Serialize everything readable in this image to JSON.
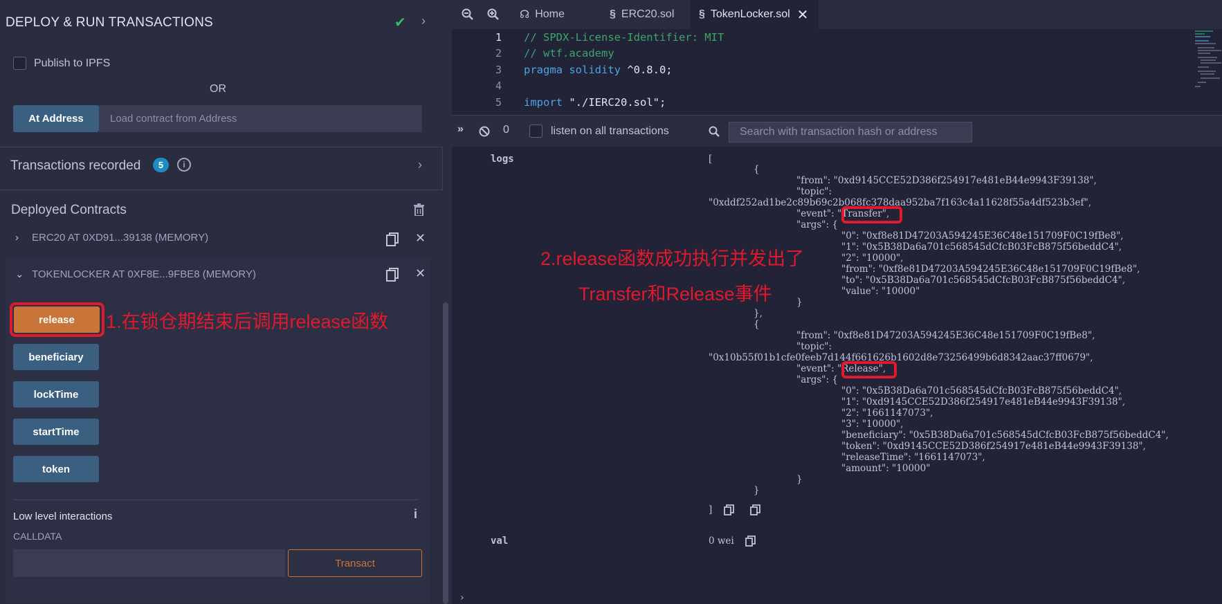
{
  "panel": {
    "title": "DEPLOY & RUN TRANSACTIONS",
    "publish_label": "Publish to IPFS",
    "or_text": "OR",
    "at_address_label": "At Address",
    "at_address_placeholder": "Load contract from Address",
    "transactions_label": "Transactions recorded",
    "transactions_count": "5",
    "deployed_label": "Deployed Contracts",
    "contracts": [
      {
        "label": "ERC20 AT 0XD91...39138 (MEMORY)"
      },
      {
        "label": "TOKENLOCKER AT 0XF8E...9FBE8 (MEMORY)"
      }
    ],
    "functions": [
      "release",
      "beneficiary",
      "lockTime",
      "startTime",
      "token"
    ],
    "low_level_label": "Low level interactions",
    "calldata_label": "CALLDATA",
    "transact_label": "Transact",
    "annotation1": "1.在锁仓期结束后调用release函数"
  },
  "tabs": [
    {
      "label": "Home"
    },
    {
      "label": "ERC20.sol"
    },
    {
      "label": "TokenLocker.sol"
    }
  ],
  "editor": {
    "lines": [
      {
        "n": "1",
        "text": "// SPDX-License-Identifier: MIT"
      },
      {
        "n": "2",
        "text": "// wtf.academy"
      },
      {
        "n": "3",
        "kw": "pragma solidity",
        "rest": " ^0.8.0;"
      },
      {
        "n": "4",
        "text": ""
      },
      {
        "n": "5",
        "kw": "import",
        "rest": " \"./IERC20.sol\";"
      }
    ]
  },
  "terminal_bar": {
    "count": "0",
    "listen_label": "listen on all transactions",
    "search_placeholder": "Search with transaction hash or address"
  },
  "log": {
    "logs_key": "logs",
    "val_key": "val",
    "val_value": "0 wei",
    "open_bracket": "[",
    "close_bracket": "]",
    "lines1": [
      "{",
      "\"from\": \"0xd9145CCE52D386f254917e481eB44e9943F39138\",",
      "\"topic\":",
      "\"0xddf252ad1be2c89b69c2b068fc378daa952ba7f163c4a11628f55a4df523b3ef\",",
      "\"event\": \"Transfer\",",
      "\"args\": {",
      "\"0\": \"0xf8e81D47203A594245E36C48e151709F0C19fBe8\",",
      "\"1\": \"0x5B38Da6a701c568545dCfcB03FcB875f56beddC4\",",
      "\"2\": \"10000\",",
      "\"from\": \"0xf8e81D47203A594245E36C48e151709F0C19fBe8\",",
      "\"to\": \"0x5B38Da6a701c568545dCfcB03FcB875f56beddC4\",",
      "\"value\": \"10000\"",
      "}",
      "},"
    ],
    "lines2": [
      "{",
      "\"from\": \"0xf8e81D47203A594245E36C48e151709F0C19fBe8\",",
      "\"topic\":",
      "\"0x10b55f01b1cfe0feeb7d144f661626b1602d8e73256499b6d8342aac37ff0679\",",
      "\"event\": \"Release\",",
      "\"args\": {",
      "\"0\": \"0x5B38Da6a701c568545dCfcB03FcB875f56beddC4\",",
      "\"1\": \"0xd9145CCE52D386f254917e481eB44e9943F39138\",",
      "\"2\": \"1661147073\",",
      "\"3\": \"10000\",",
      "\"beneficiary\": \"0x5B38Da6a701c568545dCfcB03FcB875f56beddC4\",",
      "\"token\": \"0xd9145CCE52D386f254917e481eB44e9943F39138\",",
      "\"releaseTime\": \"1661147073\",",
      "\"amount\": \"10000\"",
      "}",
      "}"
    ],
    "annotation2_line1": "2.release函数成功执行并发出了",
    "annotation2_line2": "Transfer和Release事件"
  },
  "colors": {
    "panel_bg": "#2a2c3f",
    "main_bg": "#222336",
    "accent_orange": "#c97539",
    "button_blue": "#3b5f80",
    "annotation_red": "#e0192d",
    "success_green": "#2fbd6e"
  }
}
